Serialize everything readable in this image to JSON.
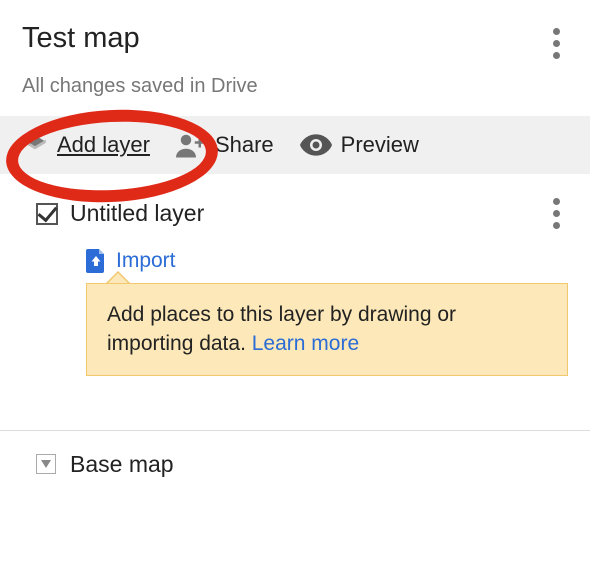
{
  "header": {
    "title": "Test map"
  },
  "save_status": "All changes saved in Drive",
  "toolbar": {
    "add_layer_label": "Add layer",
    "share_label": "Share",
    "preview_label": "Preview"
  },
  "layer": {
    "name": "Untitled layer",
    "import_label": "Import"
  },
  "popover": {
    "text": "Add places to this layer by drawing or importing data. ",
    "link_text": "Learn more"
  },
  "basemap": {
    "label": "Base map"
  }
}
